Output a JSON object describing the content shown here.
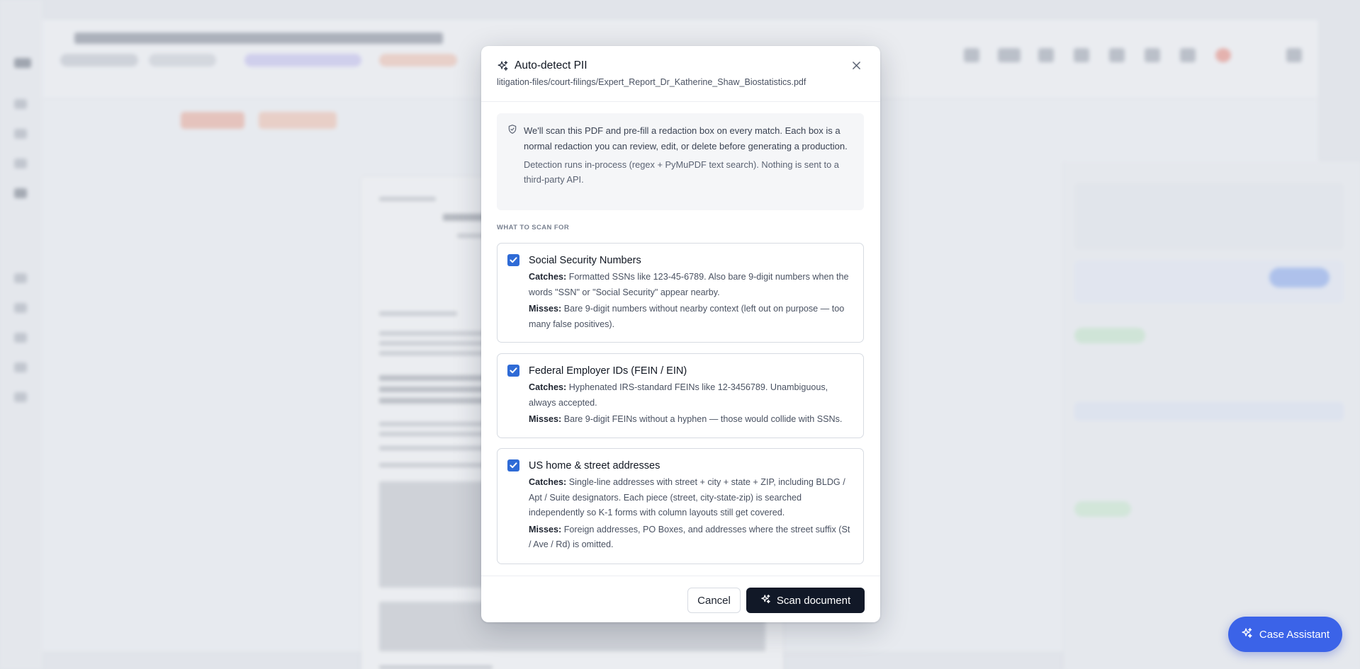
{
  "modal": {
    "title": "Auto-detect PII",
    "path": "litigation-files/court-filings/Expert_Report_Dr_Katherine_Shaw_Biostatistics.pdf",
    "info": {
      "p1": "We'll scan this PDF and pre-fill a redaction box on every match. Each box is a normal redaction you can review, edit, or delete before generating a production.",
      "p2": "Detection runs in-process (regex + PyMuPDF text search). Nothing is sent to a third-party API."
    },
    "section_label": "WHAT TO SCAN FOR",
    "options": [
      {
        "title": "Social Security Numbers",
        "checked": true,
        "catches_label": "Catches:",
        "catches": "Formatted SSNs like 123-45-6789. Also bare 9-digit numbers when the words \"SSN\" or \"Social Security\" appear nearby.",
        "misses_label": "Misses:",
        "misses": "Bare 9-digit numbers without nearby context (left out on purpose — too many false positives)."
      },
      {
        "title": "Federal Employer IDs (FEIN / EIN)",
        "checked": true,
        "catches_label": "Catches:",
        "catches": "Hyphenated IRS-standard FEINs like 12-3456789. Unambiguous, always accepted.",
        "misses_label": "Misses:",
        "misses": "Bare 9-digit FEINs without a hyphen — those would collide with SSNs."
      },
      {
        "title": "US home & street addresses",
        "checked": true,
        "catches_label": "Catches:",
        "catches": "Single-line addresses with street + city + state + ZIP, including BLDG / Apt / Suite designators. Each piece (street, city-state-zip) is searched independently so K-1 forms with column layouts still get covered.",
        "misses_label": "Misses:",
        "misses": "Foreign addresses, PO Boxes, and addresses where the street suffix (St / Ave / Rd) is omitted."
      }
    ],
    "cancel_label": "Cancel",
    "scan_label": "Scan document"
  },
  "assistant": {
    "label": "Case Assistant"
  },
  "colors": {
    "primary_dark": "#111827",
    "checkbox_blue": "#2f6bd6",
    "assistant_blue": "#3b63e8"
  },
  "icons": {
    "title": "sparkle-icon",
    "close": "close-icon",
    "info": "shield-icon",
    "check": "check-icon",
    "scan": "sparkle-icon",
    "assistant": "sparkle-icon"
  }
}
